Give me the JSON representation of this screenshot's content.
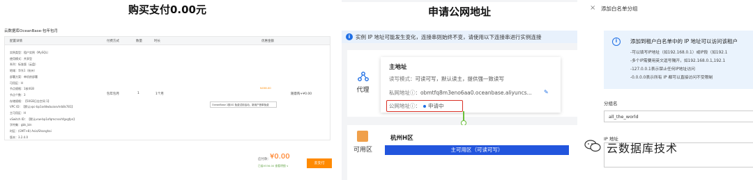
{
  "panel1": {
    "heading": "购买支付0.00元",
    "order_title": "云数据库OceanBase-包年包月",
    "headers": [
      "配置详情",
      "付费方式",
      "数量",
      "时长",
      "",
      "优惠金额"
    ],
    "config_lines": [
      "实例类型：租户实例（MySQL）",
      "使用模式：共享型",
      "系列：标准版（云盘）",
      "地域：华东1（杭州）",
      "部署方案：单机房部署",
      "可用区：H",
      "节点规格：1核4GB",
      "节点个数：3",
      "存储规格：【50GB日志空间 1】",
      "VPC ID：【默认vpc-bp1oddwbuiosvhrb8s781】",
      "主可用区：H",
      "vSwitch ID：【默认vsw-bp1ofqmcnsvhfgvgfpn】",
      "字符集：gbk_bin",
      "时区：(GMT+8) Asia/Shanghai",
      "版本：3.2.4.0"
    ],
    "pay_type": "包年包月",
    "quantity": "1",
    "duration": "1个月",
    "price_small": "¥458.00",
    "tooltip": "OceanBase 1核4G 免费试用活动，新用户首单免费",
    "discount": "随意购+¥0.00",
    "pay_label": "应付款：",
    "pay_amount": "¥0.00",
    "pay_sub": "已省¥336.00  查看明细 ∨",
    "pay_button": "去支付"
  },
  "panel2": {
    "heading": "申请公网地址",
    "notice": "实例 IP 地址可能发生变化，连接串则始终不变，请使用以下连接串进行实例连接",
    "side_label": "代理",
    "popup_title": "主地址",
    "rw_mode_label": "读写模式：",
    "rw_mode_value": "可读可写，默认读主，提供强一致读写",
    "private_label": "私网地址",
    "private_value": "obmtfq8m3eno6aa0.oceanbase.aliyuncs...",
    "public_label": "公网地址",
    "public_status": "申请中",
    "side2_label": "可用区",
    "zone_name": "杭州H区",
    "zone_bar": "主可用区（可读可写）"
  },
  "panel3": {
    "close": "×",
    "title": "添加白名单分组",
    "info_head": "添加到租户白名单中的 IP 地址可以访问该租户",
    "info_lines": [
      "-可以填写IP地址（如192.168.0.1）或IP段（如192.1",
      "-多个IP需要用英文逗号隔开，如192.168.0.1,192.1",
      "-127.0.0.1表示禁止任何IP地址访问",
      "-0.0.0.0表示所有 IP 都可以直接访问不受限制"
    ],
    "group_label": "分组名",
    "group_value": "all_the_world",
    "ip_label": "IP 地址",
    "watermark": "云数据库技术"
  },
  "colors": {
    "accent_blue": "#1f6fe5",
    "orange": "#ff8a00",
    "zone_blue": "#2255dd",
    "alert_red": "#d93025",
    "green": "#6abf3a"
  }
}
